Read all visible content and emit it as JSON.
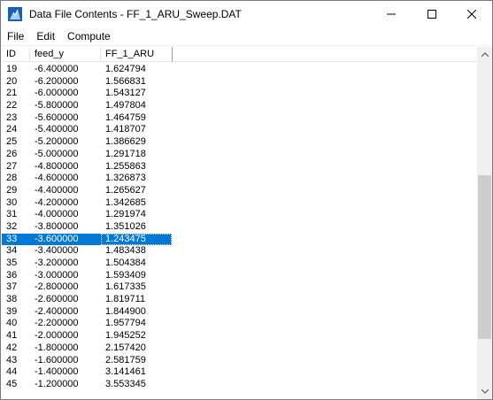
{
  "window": {
    "title": "Data File Contents - FF_1_ARU_Sweep.DAT",
    "icon": "app-icon",
    "controls": {
      "minimize": "minimize-icon",
      "maximize": "maximize-icon",
      "close": "close-icon"
    }
  },
  "menu": {
    "items": [
      "File",
      "Edit",
      "Compute"
    ]
  },
  "table": {
    "columns": [
      "ID",
      "feed_y",
      "FF_1_ARU"
    ],
    "selected_id": "33",
    "rows": [
      [
        "19",
        "-6.400000",
        "1.624794"
      ],
      [
        "20",
        "-6.200000",
        "1.566831"
      ],
      [
        "21",
        "-6.000000",
        "1.543127"
      ],
      [
        "22",
        "-5.800000",
        "1.497804"
      ],
      [
        "23",
        "-5.600000",
        "1.464759"
      ],
      [
        "24",
        "-5.400000",
        "1.418707"
      ],
      [
        "25",
        "-5.200000",
        "1.386629"
      ],
      [
        "26",
        "-5.000000",
        "1.291718"
      ],
      [
        "27",
        "-4.800000",
        "1.255863"
      ],
      [
        "28",
        "-4.600000",
        "1.326873"
      ],
      [
        "29",
        "-4.400000",
        "1.265627"
      ],
      [
        "30",
        "-4.200000",
        "1.342685"
      ],
      [
        "31",
        "-4.000000",
        "1.291974"
      ],
      [
        "32",
        "-3.800000",
        "1.351026"
      ],
      [
        "33",
        "-3.600000",
        "1.243475"
      ],
      [
        "34",
        "-3.400000",
        "1.483438"
      ],
      [
        "35",
        "-3.200000",
        "1.504384"
      ],
      [
        "36",
        "-3.000000",
        "1.593409"
      ],
      [
        "37",
        "-2.800000",
        "1.617335"
      ],
      [
        "38",
        "-2.600000",
        "1.819711"
      ],
      [
        "39",
        "-2.400000",
        "1.844900"
      ],
      [
        "40",
        "-2.200000",
        "1.957794"
      ],
      [
        "41",
        "-2.000000",
        "1.945252"
      ],
      [
        "42",
        "-1.800000",
        "2.157420"
      ],
      [
        "43",
        "-1.600000",
        "2.581759"
      ],
      [
        "44",
        "-1.400000",
        "3.141461"
      ],
      [
        "45",
        "-1.200000",
        "3.553345"
      ]
    ]
  },
  "colors": {
    "selection": "#0078d7",
    "scroll_thumb": "#cdcdcd",
    "scroll_track": "#f0f0f0"
  }
}
